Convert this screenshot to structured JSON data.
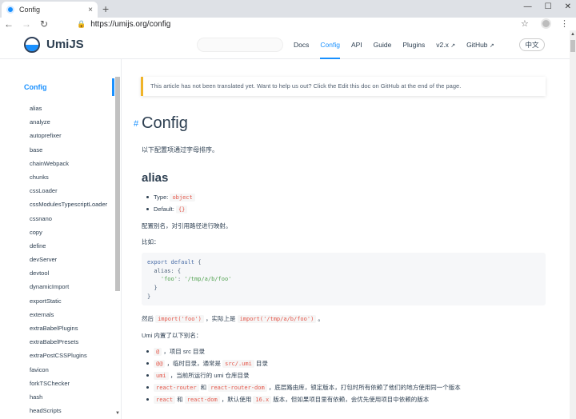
{
  "browser": {
    "tab_title": "Config",
    "tab_close": "×",
    "new_tab": "+",
    "window_controls": [
      "—",
      "☐",
      "✕"
    ],
    "back": "←",
    "forward": "→",
    "reload": "↻",
    "lock_icon": "🔒",
    "url": "https://umijs.org/config",
    "bookmark": "☆",
    "menu": "⋮"
  },
  "header": {
    "brand": "UmiJS",
    "nav": [
      "Docs",
      "Config",
      "API",
      "Guide",
      "Plugins",
      "v2.x",
      "GitHub"
    ],
    "active_nav": "Config",
    "external_mark": "↗",
    "lang": "中文"
  },
  "sidebar": {
    "title": "Config",
    "items": [
      "alias",
      "analyze",
      "autoprefixer",
      "base",
      "chainWebpack",
      "chunks",
      "cssLoader",
      "cssModulesTypescriptLoader",
      "cssnano",
      "copy",
      "define",
      "devServer",
      "devtool",
      "dynamicImport",
      "exportStatic",
      "externals",
      "extraBabelPlugins",
      "extraBabelPresets",
      "extraPostCSSPlugins",
      "favicon",
      "forkTSChecker",
      "hash",
      "headScripts"
    ],
    "scroll_arrow": "▼"
  },
  "main": {
    "notice": "This article has not been translated yet. Want to help us out? Click the Edit this doc on GitHub at the end of the page.",
    "anchor": "#",
    "title": "Config",
    "intro": "以下配置项通过字母排序。",
    "section_title": "alias",
    "type_label": "Type:",
    "type_value": "object",
    "default_label": "Default:",
    "default_value": "{}",
    "desc": "配置别名，对引用路径进行映射。",
    "example_label": "比如：",
    "code": {
      "l1_kw": "export default",
      "l1_rest": " {",
      "l2": "  alias: {",
      "l3_key": "    'foo'",
      "l3_sep": ": ",
      "l3_val": "'/tmp/a/b/foo'",
      "l4": "  }",
      "l5": "}"
    },
    "then": {
      "a": "然后 ",
      "code1": "import('foo')",
      "b": " ，实际上是 ",
      "code2": "import('/tmp/a/b/foo')",
      "c": " 。"
    },
    "builtin_title": "Umi 内置了以下别名：",
    "aliases": [
      {
        "code": "@",
        "text": " ，项目 src 目录"
      },
      {
        "code": "@@",
        "text": " ，临时目录，通常是 ",
        "code2": "src/.umi",
        "text2": " 目录"
      },
      {
        "code": "umi",
        "text": " ，当前所运行的 umi 仓库目录"
      },
      {
        "code": "react-router",
        "text": " 和 ",
        "code2": "react-router-dom",
        "text2": " ，底层路由库，锁定版本，打包时所有依赖了他们的地方使用同一个版本"
      },
      {
        "code": "react",
        "text": " 和 ",
        "code2": "react-dom",
        "text2": " ，默认使用 ",
        "code3": "16.x",
        "text3": " 版本，但如果项目里有依赖，会优先使用项目中依赖的版本"
      }
    ]
  },
  "colors": {
    "accent": "#1890ff",
    "text": "#2c3e50",
    "code_red": "#e45649",
    "notice_border": "#f0b429"
  },
  "icons": {
    "up_arrow": "▲"
  }
}
